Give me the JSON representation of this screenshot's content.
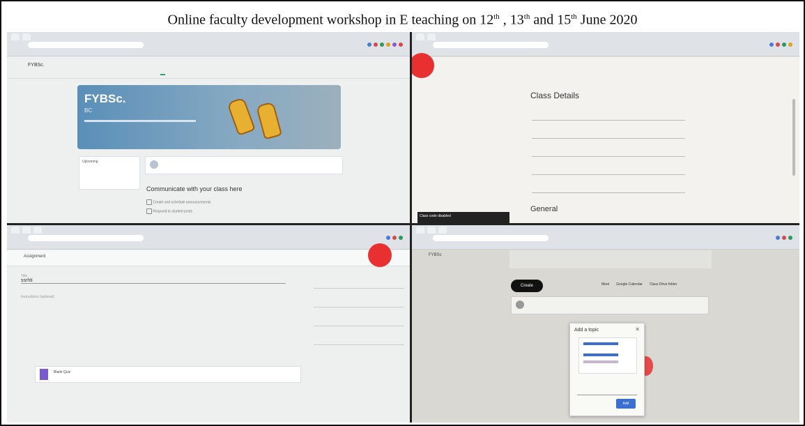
{
  "title": {
    "prefix": "Online faculty development workshop in E teaching on 12",
    "sup1": "th",
    "sep1": " , 13",
    "sup2": "th",
    "sep2": " and 15",
    "sup3": "th",
    "suffix": " June 2020"
  },
  "q1": {
    "class_name": "FYBSc.",
    "banner_title": "FYBSc.",
    "banner_sub": "BC",
    "communicate": "Communicate with your class here",
    "link1": "Create and schedule announcements",
    "link2": "Respond to student posts",
    "upcoming": "Upcoming"
  },
  "q2": {
    "class_details": "Class Details",
    "general": "General",
    "toast": "Class code disabled"
  },
  "q3": {
    "heading": "Assignment",
    "title_label": "Title",
    "title_value": "ssrhti",
    "instructions": "Instructions (optional)",
    "blank_quiz": "Blank Quiz"
  },
  "q4": {
    "class_name": "FYBSc",
    "create": "Create",
    "modal_title": "Add a topic",
    "add": "Add",
    "meet": "Meet",
    "google_calendar": "Google Calendar",
    "class_drive_folder": "Class Drive folder"
  }
}
